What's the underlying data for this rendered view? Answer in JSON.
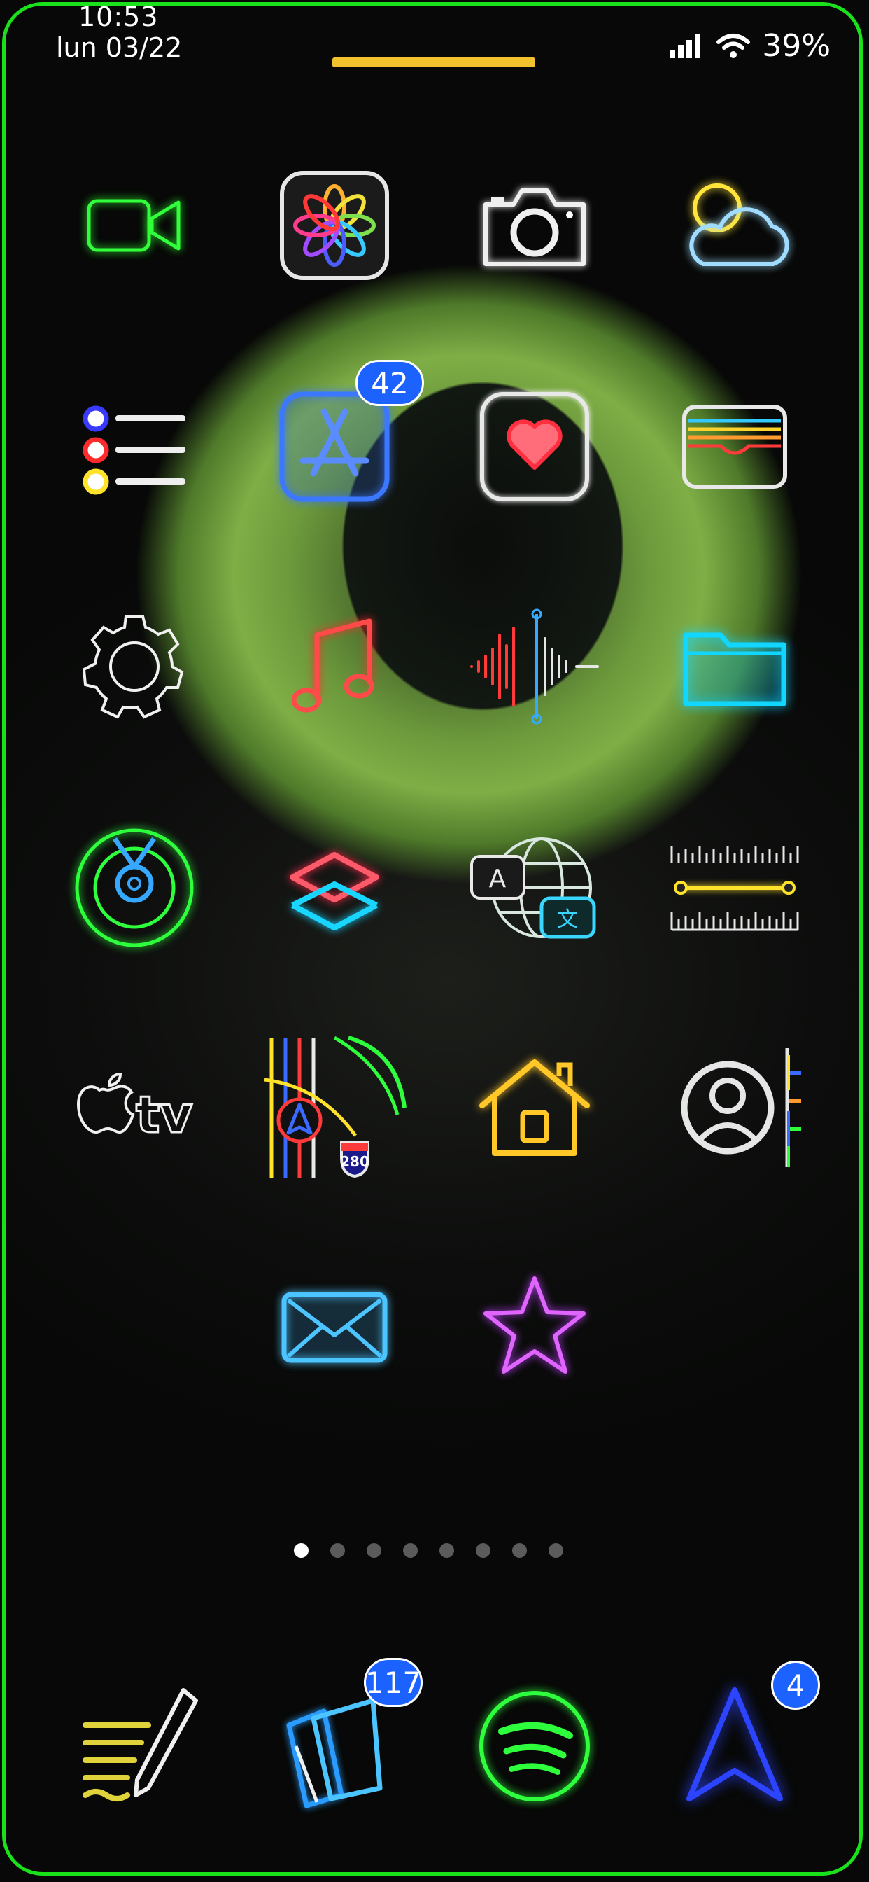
{
  "status_bar": {
    "time": "10:53",
    "date": "lun 03/22",
    "battery": "39%"
  },
  "apps": [
    {
      "icon": "facetime-icon"
    },
    {
      "icon": "photos-icon"
    },
    {
      "icon": "camera-icon"
    },
    {
      "icon": "weather-icon"
    },
    {
      "icon": "reminders-icon"
    },
    {
      "icon": "app-store-icon",
      "badge": "42"
    },
    {
      "icon": "health-icon"
    },
    {
      "icon": "wallet-icon"
    },
    {
      "icon": "settings-icon"
    },
    {
      "icon": "music-icon"
    },
    {
      "icon": "voice-memos-icon"
    },
    {
      "icon": "files-icon"
    },
    {
      "icon": "find-my-icon"
    },
    {
      "icon": "shortcuts-icon"
    },
    {
      "icon": "translate-icon"
    },
    {
      "icon": "measure-icon"
    },
    {
      "icon": "apple-tv-icon",
      "label": "tv"
    },
    {
      "icon": "maps-icon",
      "label": "280"
    },
    {
      "icon": "home-icon"
    },
    {
      "icon": "contacts-icon"
    },
    {
      "icon": "mail-icon"
    },
    {
      "icon": "itunes-store-icon"
    }
  ],
  "page_indicator": {
    "count": 8,
    "active": 1
  },
  "dock": [
    {
      "icon": "notes-icon"
    },
    {
      "icon": "cards-icon",
      "badge": "117"
    },
    {
      "icon": "spotify-icon"
    },
    {
      "icon": "navigation-icon",
      "badge": "4"
    }
  ],
  "colors": {
    "frame": "#19e11a",
    "badge": "#1c62ff",
    "top_bar": "#f2c12e"
  }
}
